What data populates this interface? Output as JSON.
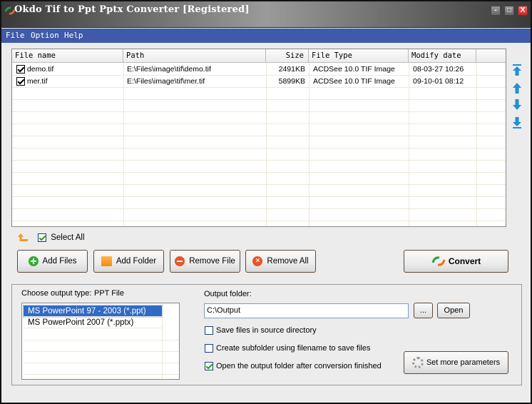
{
  "window": {
    "title": "Okdo Tif to Ppt Pptx Converter [Registered]",
    "minimize": "-",
    "maximize": "□",
    "close": "X"
  },
  "menu": [
    "File",
    "Option",
    "Help"
  ],
  "file_list": {
    "columns": [
      "File name",
      "Path",
      "Size",
      "File Type",
      "Modify date"
    ],
    "rows": [
      {
        "checked": true,
        "name": "demo.tif",
        "path": "E:\\Files\\image\\tif\\demo.tif",
        "size": "2491KB",
        "type": "ACDSee 10.0 TIF Image",
        "date": "08-03-27 10:26"
      },
      {
        "checked": true,
        "name": "mer.tif",
        "path": "E:\\Files\\image\\tif\\mer.tif",
        "size": "5899KB",
        "type": "ACDSee 10.0 TIF Image",
        "date": "09-10-01 08:12"
      }
    ]
  },
  "order_buttons": [
    "move-top",
    "move-up",
    "move-down",
    "move-bottom"
  ],
  "select_all": {
    "label": "Select All",
    "checked": true
  },
  "buttons": {
    "add_files": "Add Files",
    "add_folder": "Add Folder",
    "remove_file": "Remove File",
    "remove_all": "Remove All",
    "convert": "Convert"
  },
  "output": {
    "type_label": "Choose output type:",
    "type_value": "PPT File",
    "types": [
      "MS PowerPoint 97 - 2003 (*.ppt)",
      "MS PowerPoint 2007 (*.pptx)"
    ],
    "selected_type_index": 0,
    "folder_label": "Output folder:",
    "folder_value": "C:\\Output",
    "browse_label": "...",
    "open_label": "Open",
    "options": [
      {
        "label": "Save files in source directory",
        "checked": false
      },
      {
        "label": "Create subfolder using filename to save files",
        "checked": false
      },
      {
        "label": "Open the output folder after conversion finished",
        "checked": true
      }
    ],
    "more_params_label": "Set more parameters"
  },
  "colors": {
    "menubar": "#3f5aa8",
    "selection": "#316ac5",
    "check_green": "#21a121",
    "arrow_blue": "#1e90d8",
    "arrow_orange": "#f39a26"
  }
}
